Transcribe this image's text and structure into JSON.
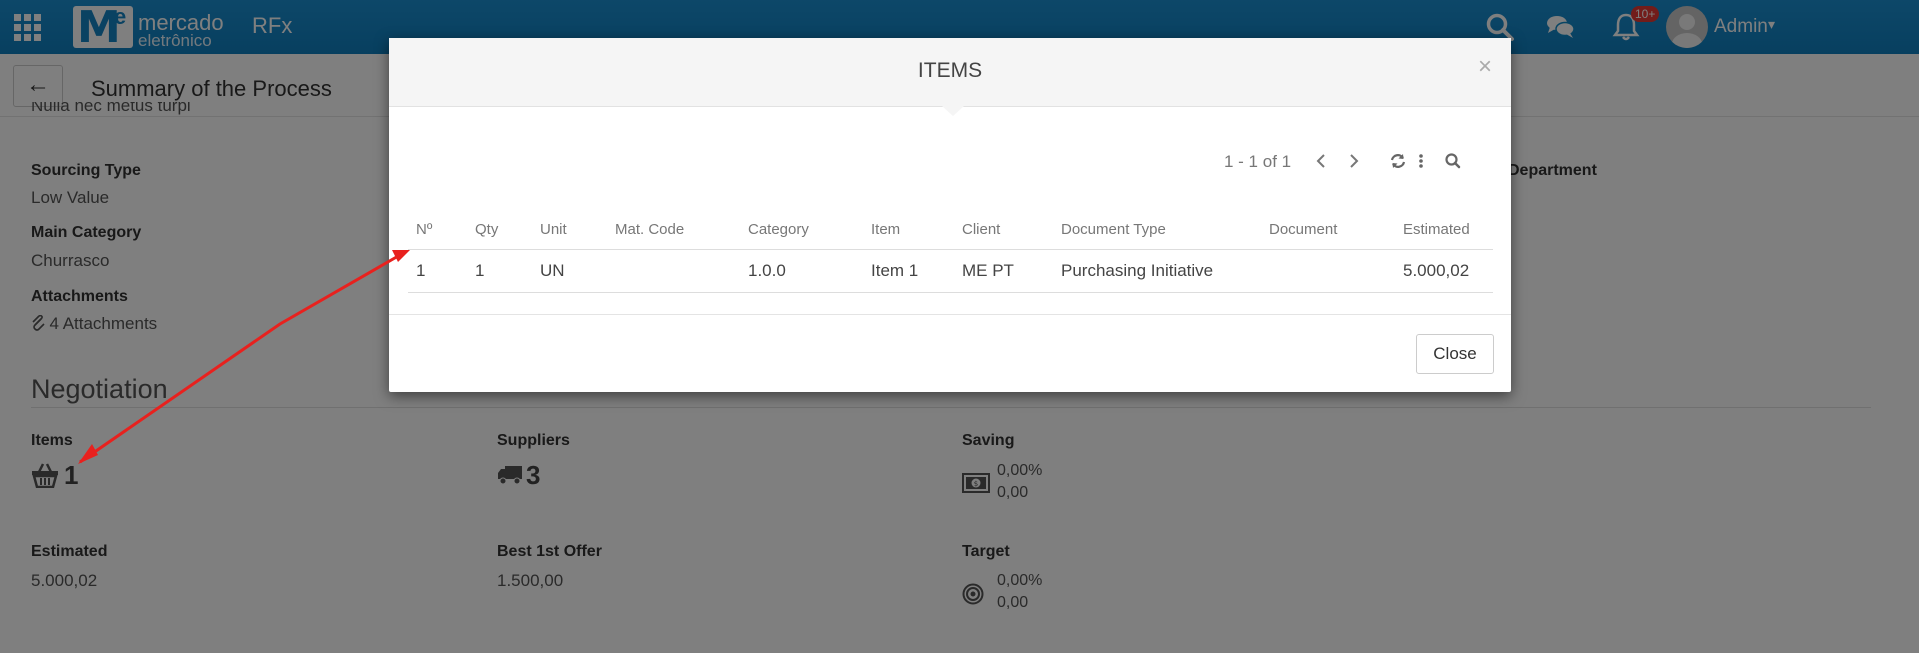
{
  "topbar": {
    "brand_line1": "mercado",
    "brand_line2": "eletrônico",
    "brand_letter_m": "M",
    "brand_letter_e": "e",
    "app_name": "RFx",
    "notification_badge": "10+",
    "user_name": "Admin",
    "accent_color": "#1584c4"
  },
  "page": {
    "title": "Summary of the Process",
    "partial_description": "Nulla nec metus turpi",
    "fields": {
      "sourcing_type_label": "Sourcing Type",
      "sourcing_type_value": "Low Value",
      "main_category_label": "Main Category",
      "main_category_value": "Churrasco",
      "attachments_label": "Attachments",
      "attachments_value": "4 Attachments",
      "department_label": "Department"
    },
    "negotiation": {
      "title": "Negotiation",
      "items_label": "Items",
      "items_value": "1",
      "suppliers_label": "Suppliers",
      "suppliers_value": "3",
      "saving_label": "Saving",
      "saving_percent": "0,00%",
      "saving_value": "0,00",
      "estimated_label": "Estimated",
      "estimated_value": "5.000,02",
      "best_offer_label": "Best 1st Offer",
      "best_offer_value": "1.500,00",
      "target_label": "Target",
      "target_percent": "0,00%",
      "target_value": "0,00"
    }
  },
  "modal": {
    "title": "ITEMS",
    "close_x": "×",
    "pager_text": "1 - 1 of 1",
    "close_button": "Close",
    "columns": [
      "Nº",
      "Qty",
      "Unit",
      "Mat. Code",
      "Category",
      "Item",
      "Client",
      "Document Type",
      "Document",
      "Estimated"
    ],
    "rows": [
      [
        "1",
        "1",
        "UN",
        "",
        "1.0.0",
        "Item 1",
        "ME PT",
        "Purchasing Initiative",
        "",
        "5.000,02"
      ]
    ]
  }
}
